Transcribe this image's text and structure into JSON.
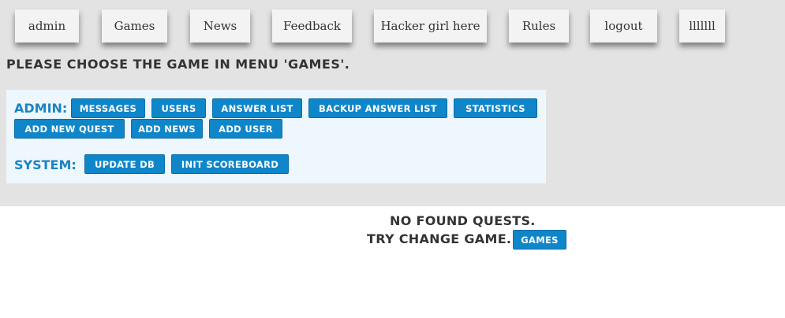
{
  "nav": {
    "items": [
      {
        "label": "admin"
      },
      {
        "label": "Games"
      },
      {
        "label": "News"
      },
      {
        "label": "Feedback"
      },
      {
        "label": "Hacker girl here"
      },
      {
        "label": "Rules"
      },
      {
        "label": "logout"
      },
      {
        "label": "lllllll"
      }
    ]
  },
  "notice": "PLEASE CHOOSE THE GAME IN MENU 'GAMES'.",
  "admin": {
    "label": "ADMIN:",
    "buttons": [
      {
        "label": "MESSAGES"
      },
      {
        "label": "USERS"
      },
      {
        "label": "ANSWER LIST"
      },
      {
        "label": "BACKUP ANSWER LIST"
      },
      {
        "label": "STATISTICS"
      },
      {
        "label": "ADD NEW QUEST"
      },
      {
        "label": "ADD NEWS"
      },
      {
        "label": "ADD USER"
      }
    ]
  },
  "system": {
    "label": "SYSTEM:",
    "buttons": [
      {
        "label": "UPDATE DB"
      },
      {
        "label": "INIT SCOREBOARD"
      }
    ]
  },
  "main": {
    "no_quests": "NO FOUND QUESTS.",
    "try_change": "TRY CHANGE GAME.",
    "games_button": "GAMES"
  }
}
